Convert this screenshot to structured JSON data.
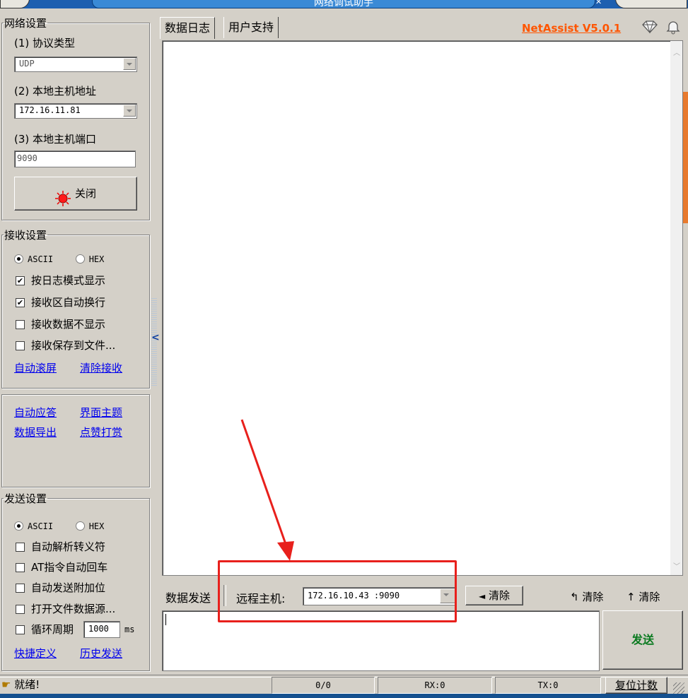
{
  "window": {
    "title": "网络调试助手"
  },
  "network_settings": {
    "legend": "网络设置",
    "protocol_label": "(1) 协议类型",
    "protocol_value": "UDP",
    "local_host_label": "(2) 本地主机地址",
    "local_host_value": "172.16.11.81",
    "local_port_label": "(3) 本地主机端口",
    "local_port_value": "9090",
    "close_button": "关闭"
  },
  "receive_settings": {
    "legend": "接收设置",
    "mode_ascii": "ASCII",
    "mode_hex": "HEX",
    "log_mode": "按日志模式显示",
    "auto_wrap": "接收区自动换行",
    "hide_data": "接收数据不显示",
    "save_to_file": "接收保存到文件...",
    "auto_scroll": "自动滚屏",
    "clear_receive": "清除接收"
  },
  "extras": {
    "auto_reply": "自动应答",
    "theme": "界面主题",
    "export": "数据导出",
    "donate": "点赞打赏"
  },
  "send_settings": {
    "legend": "发送设置",
    "mode_ascii": "ASCII",
    "mode_hex": "HEX",
    "parse_escape": "自动解析转义符",
    "at_cr": "AT指令自动回车",
    "append_check": "自动发送附加位",
    "open_file": "打开文件数据源...",
    "loop_period": "循环周期",
    "loop_value": "1000",
    "loop_unit": "ms",
    "shortcuts": "快捷定义",
    "history": "历史发送"
  },
  "tabs": {
    "log": "数据日志",
    "support": "用户支持"
  },
  "header": {
    "version": "NetAssist V5.0.1"
  },
  "send_bar": {
    "label": "数据发送",
    "remote_label": "远程主机:",
    "remote_value": "172.16.10.43 :9090",
    "clear1": "清除",
    "clear2": "清除",
    "clear3": "清除",
    "send_button": "发送"
  },
  "statusbar": {
    "ready": "就绪!",
    "counter": "0/0",
    "rx": "RX:0",
    "tx": "TX:0",
    "reset": "复位计数"
  },
  "colors": {
    "annotation": "#e8201c",
    "link": "#0000ee",
    "version": "#ff5500"
  }
}
